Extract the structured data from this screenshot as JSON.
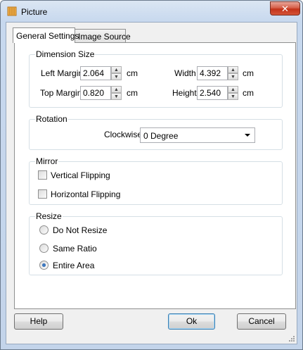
{
  "window": {
    "title": "Picture",
    "close_glyph": "✕"
  },
  "tabs": [
    {
      "label": "General Settings",
      "active": true
    },
    {
      "label": "Image Source",
      "active": false
    }
  ],
  "dimension": {
    "title": "Dimension Size",
    "left_margin": {
      "label": "Left Margin",
      "value": "2.064",
      "unit": "cm"
    },
    "top_margin": {
      "label": "Top Margin",
      "value": "0.820",
      "unit": "cm"
    },
    "width": {
      "label": "Width",
      "value": "4.392",
      "unit": "cm"
    },
    "height": {
      "label": "Height",
      "value": "2.540",
      "unit": "cm"
    }
  },
  "rotation": {
    "title": "Rotation",
    "label": "Clockwise",
    "value": "0 Degree"
  },
  "mirror": {
    "title": "Mirror",
    "vertical": {
      "label": "Vertical Flipping",
      "checked": false
    },
    "horizontal": {
      "label": "Horizontal Flipping",
      "checked": false
    }
  },
  "resize": {
    "title": "Resize",
    "options": [
      {
        "label": "Do Not Resize",
        "selected": false
      },
      {
        "label": "Same Ratio",
        "selected": false
      },
      {
        "label": "Entire Area",
        "selected": true
      }
    ]
  },
  "buttons": {
    "help": "Help",
    "ok": "Ok",
    "cancel": "Cancel"
  },
  "icons": {
    "app": "picture-app-icon",
    "spin_up": "spin-up-icon",
    "spin_down": "spin-down-icon",
    "dropdown": "chevron-down-icon",
    "grip": "resize-grip-icon"
  }
}
